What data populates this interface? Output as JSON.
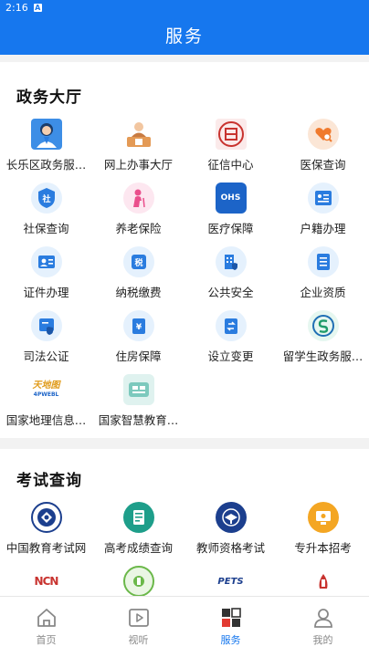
{
  "status": {
    "time": "2:16",
    "sim_label": "A"
  },
  "header": {
    "title": "服务"
  },
  "sections": {
    "gov": {
      "title": "政务大厅"
    },
    "exam": {
      "title": "考试查询"
    }
  },
  "gov_items": [
    {
      "label": "长乐区政务服…"
    },
    {
      "label": "网上办事大厅"
    },
    {
      "label": "征信中心"
    },
    {
      "label": "医保查询"
    },
    {
      "label": "社保查询"
    },
    {
      "label": "养老保险"
    },
    {
      "label": "医疗保障"
    },
    {
      "label": "户籍办理"
    },
    {
      "label": "证件办理"
    },
    {
      "label": "纳税缴费"
    },
    {
      "label": "公共安全"
    },
    {
      "label": "企业资质"
    },
    {
      "label": "司法公证"
    },
    {
      "label": "住房保障"
    },
    {
      "label": "设立变更"
    },
    {
      "label": "留学生政务服…"
    },
    {
      "label": "国家地理信息…"
    },
    {
      "label": "国家智慧教育…"
    }
  ],
  "exam_items": [
    {
      "label": "中国教育考试网"
    },
    {
      "label": "高考成绩查询"
    },
    {
      "label": "教师资格考试"
    },
    {
      "label": "专升本招考"
    }
  ],
  "icon_text": {
    "shebao": "社",
    "tax": "税",
    "housing": "¥",
    "ylbz": "OHS",
    "pets": "PETS",
    "ncn": "NCN",
    "geo_mark": "天地图",
    "geo_sub": "4PWEBL"
  },
  "nav": [
    {
      "label": "首页"
    },
    {
      "label": "视听"
    },
    {
      "label": "服务"
    },
    {
      "label": "我的"
    }
  ],
  "colors": {
    "primary": "#1677ee",
    "nav_inactive": "#888888"
  }
}
